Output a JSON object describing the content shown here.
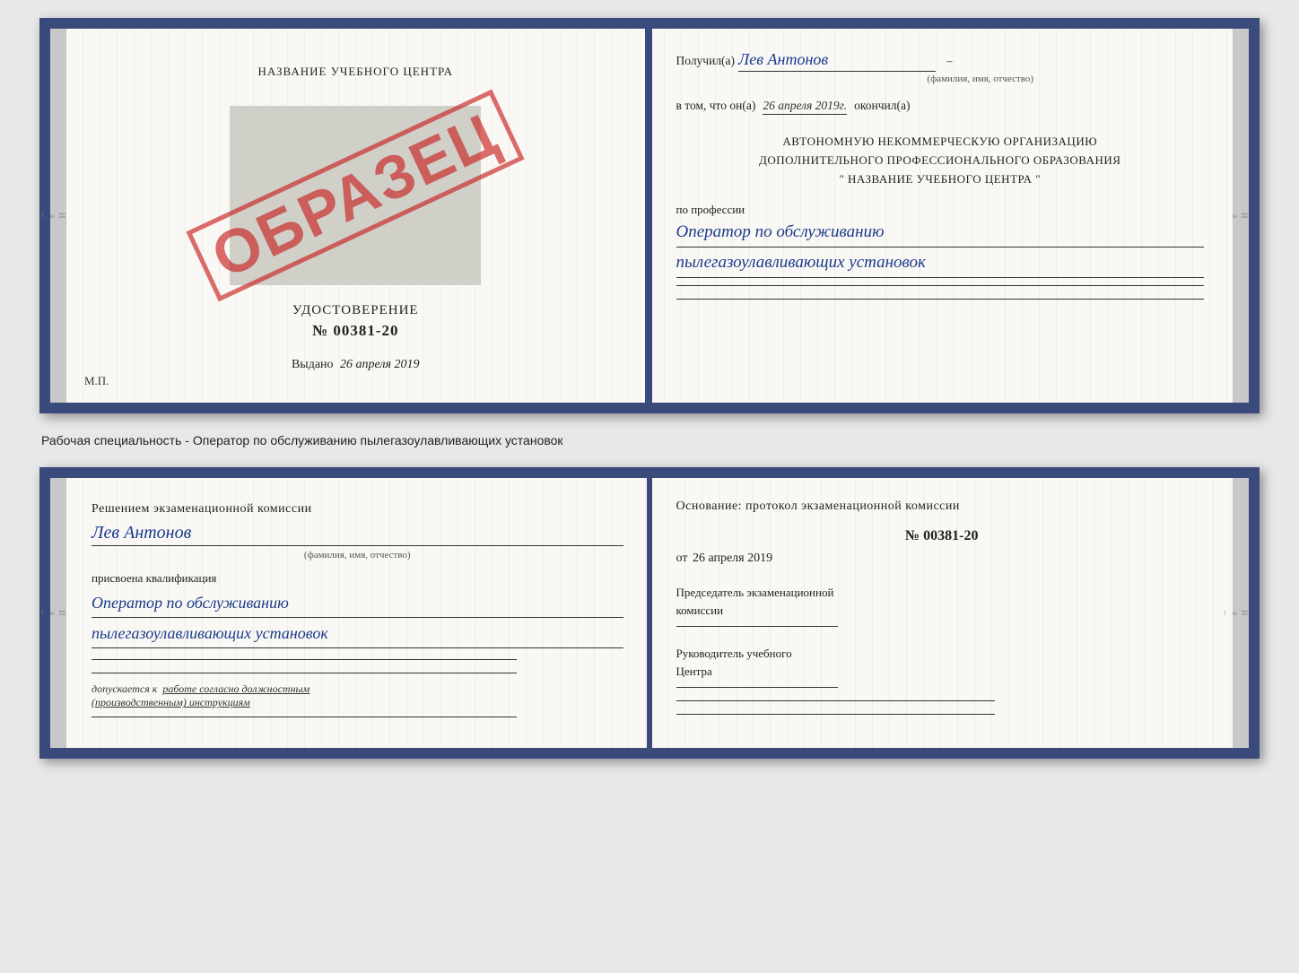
{
  "top_doc": {
    "left": {
      "school_name": "НАЗВАНИЕ УЧЕБНОГО ЦЕНТРА",
      "stamp_text": "ОБРАЗЕЦ",
      "cert_type": "УДОСТОВЕРЕНИЕ",
      "cert_number": "№ 00381-20",
      "issued_label": "Выдано",
      "issued_date": "26 апреля 2019",
      "mp": "М.П."
    },
    "right": {
      "received_prefix": "Получил(а)",
      "received_name": "Лев Антонов",
      "fio_label": "(фамилия, имя, отчество)",
      "in_fact_prefix": "в том, что он(а)",
      "date_value": "26 апреля 2019г.",
      "finished_word": "окончил(а)",
      "org_line1": "АВТОНОМНУЮ НЕКОММЕРЧЕСКУЮ ОРГАНИЗАЦИЮ",
      "org_line2": "ДОПОЛНИТЕЛЬНОГО ПРОФЕССИОНАЛЬНОГО ОБРАЗОВАНИЯ",
      "org_line3": "\"   НАЗВАНИЕ УЧЕБНОГО ЦЕНТРА   \"",
      "profession_label": "по профессии",
      "profession_line1": "Оператор по обслуживанию",
      "profession_line2": "пылегазоулавливающих установок"
    }
  },
  "separator": {
    "text": "Рабочая специальность - Оператор по обслуживанию пылегазоулавливающих установок"
  },
  "bottom_doc": {
    "left": {
      "decision_text": "Решением экзаменационной комиссии",
      "person_name": "Лев Антонов",
      "fio_label": "(фамилия, имя, отчество)",
      "assigned_label": "присвоена квалификация",
      "qualification_line1": "Оператор по обслуживанию",
      "qualification_line2": "пылегазоулавливающих установок",
      "admission_text": "допускается к   работе согласно должностным\n(производственным) инструкциям"
    },
    "right": {
      "basis_label": "Основание: протокол экзаменационной комиссии",
      "protocol_number": "№  00381-20",
      "protocol_date_prefix": "от",
      "protocol_date": "26 апреля 2019",
      "chairman_line1": "Председатель экзаменационной",
      "chairman_line2": "комиссии",
      "head_line1": "Руководитель учебного",
      "head_line2": "Центра"
    }
  }
}
